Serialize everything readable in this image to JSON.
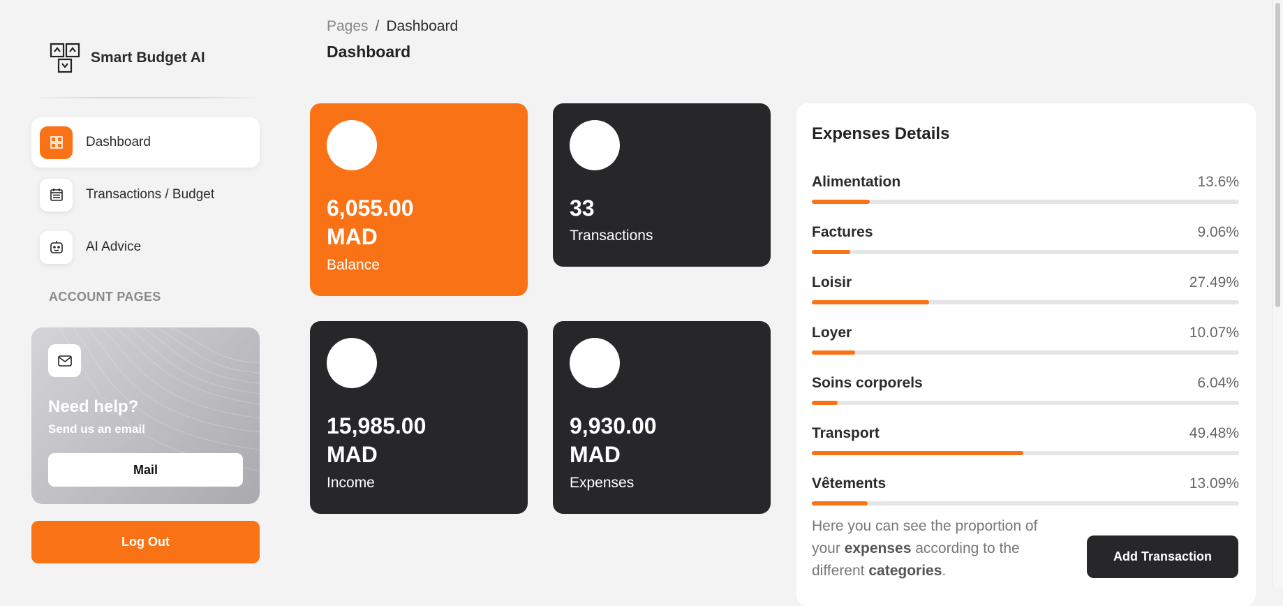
{
  "app": {
    "name": "Smart Budget AI"
  },
  "sidebar": {
    "items": [
      {
        "label": "Dashboard",
        "icon": "dashboard-icon",
        "active": true
      },
      {
        "label": "Transactions / Budget",
        "icon": "calendar-icon",
        "active": false
      },
      {
        "label": "AI Advice",
        "icon": "robot-icon",
        "active": false
      }
    ],
    "section_title": "ACCOUNT PAGES",
    "help": {
      "title": "Need help?",
      "subtitle": "Send us an email",
      "button_label": "Mail",
      "icon": "mail-icon"
    },
    "logout_label": "Log Out"
  },
  "header": {
    "breadcrumb": {
      "root": "Pages",
      "separator": "/",
      "current": "Dashboard"
    },
    "title": "Dashboard"
  },
  "stats": {
    "balance": {
      "value": "6,055.00",
      "currency": "MAD",
      "label": "Balance"
    },
    "transactions": {
      "value": "33",
      "label": "Transactions"
    },
    "income": {
      "value": "15,985.00",
      "currency": "MAD",
      "label": "Income"
    },
    "expenses": {
      "value": "9,930.00",
      "currency": "MAD",
      "label": "Expenses"
    }
  },
  "expenses_details": {
    "title": "Expenses Details",
    "categories": [
      {
        "name": "Alimentation",
        "percent_label": "13.6%",
        "percent": 13.6
      },
      {
        "name": "Factures",
        "percent_label": "9.06%",
        "percent": 9.06
      },
      {
        "name": "Loisir",
        "percent_label": "27.49%",
        "percent": 27.49
      },
      {
        "name": "Loyer",
        "percent_label": "10.07%",
        "percent": 10.07
      },
      {
        "name": "Soins corporels",
        "percent_label": "6.04%",
        "percent": 6.04
      },
      {
        "name": "Transport",
        "percent_label": "49.48%",
        "percent": 49.48
      },
      {
        "name": "Vêtements",
        "percent_label": "13.09%",
        "percent": 13.09
      }
    ],
    "note": {
      "part1": "Here you can see the proportion of your ",
      "bold1": "expenses",
      "part2": " according to the different ",
      "bold2": "categories",
      "part3": "."
    },
    "add_button_label": "Add Transaction"
  },
  "colors": {
    "accent": "#f97316",
    "dark": "#27272a",
    "background": "#f3f3f3"
  }
}
